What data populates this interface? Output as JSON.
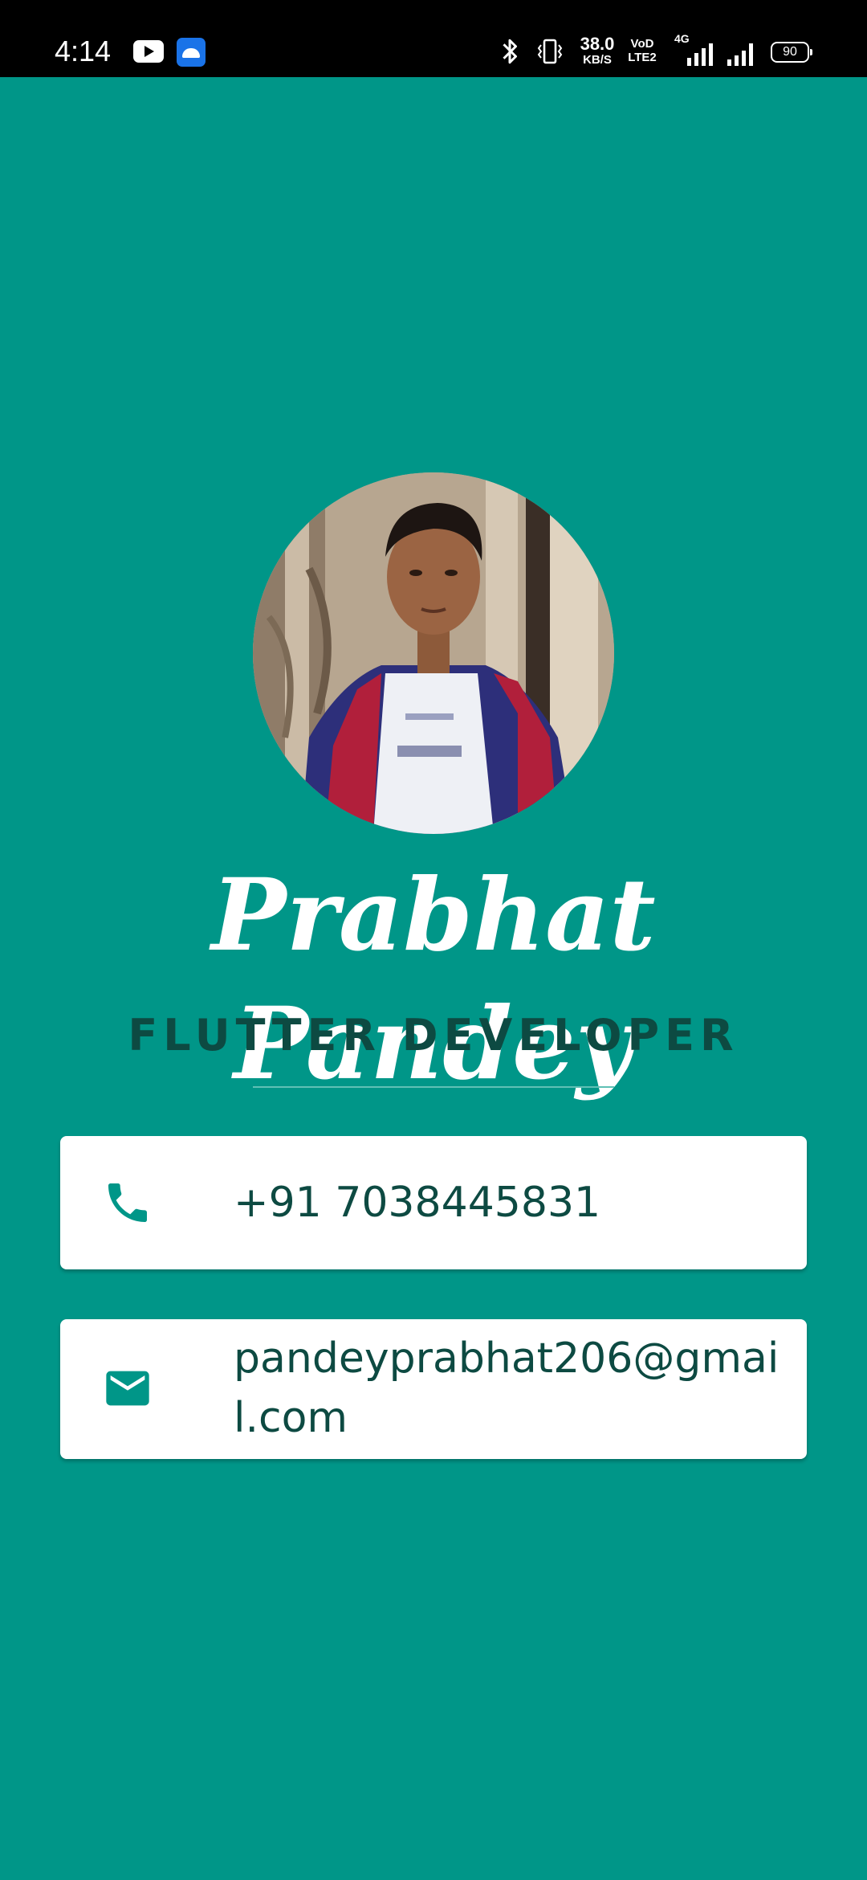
{
  "status_bar": {
    "time": "4:14",
    "network_speed_value": "38.0",
    "network_speed_unit": "KB/S",
    "volte_line1": "VoD",
    "volte_line2": "LTE2",
    "network_type": "4G",
    "battery": "90",
    "icons": [
      "youtube-icon",
      "android-icon",
      "bluetooth-icon",
      "vibrate-icon",
      "signal-icon",
      "battery-icon"
    ]
  },
  "profile": {
    "photo": "profile-photo",
    "name": "Prabhat Pandey",
    "title": "FLUTTER DEVELOPER"
  },
  "contacts": {
    "phone": {
      "icon": "phone-icon",
      "value": "+91 7038445831"
    },
    "email": {
      "icon": "mail-icon",
      "value": "pandeyprabhat206@gmail.com"
    }
  },
  "colors": {
    "background": "#009688",
    "card": "#ffffff",
    "text_dark": "#0d4a42",
    "icon": "#009688"
  }
}
